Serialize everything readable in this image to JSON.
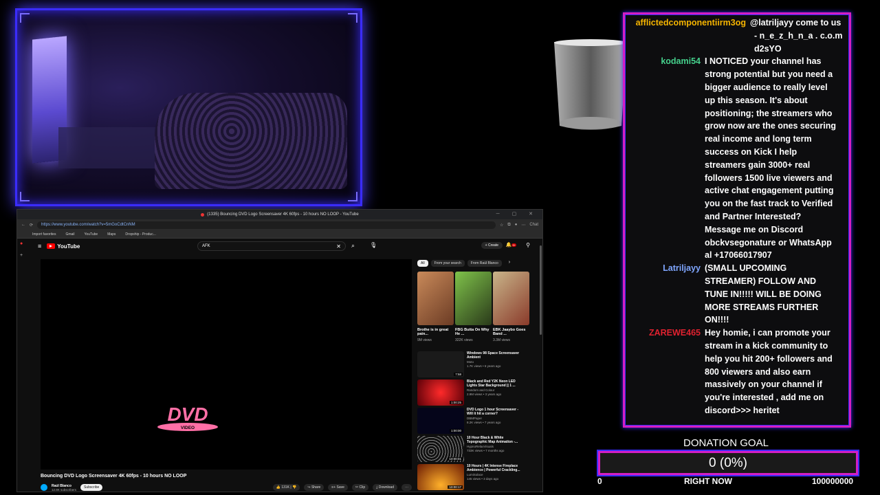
{
  "browser": {
    "tab_title": "(1335) Bouncing DVD Logo Screensaver 4K 60fps - 10 hours NO LOOP - YouTube",
    "url": "https://www.youtube.com/watch?v=5mGoCdtCnNM",
    "bookmarks": [
      "Import favorites",
      "Gmail",
      "YouTube",
      "Maps",
      "Dropship - Produc..."
    ],
    "extra_label": "Chat"
  },
  "youtube": {
    "logo": "YouTube",
    "search_value": "AFK",
    "create_label": "+ Create",
    "notif_count": "9+",
    "video_title": "Bouncing DVD Logo Screensaver 4K 60fps - 10 hours NO LOOP",
    "channel_name": "Raúl Blanco",
    "subscribers": "12.8K subscribers",
    "subscribe_label": "Subscribe",
    "likes": "131K",
    "actions": [
      "Share",
      "Save",
      "Clip",
      "Download"
    ],
    "dvd_text": "DVD",
    "dvd_sub": "VIDEO",
    "chips": [
      "All",
      "From your search",
      "From Raúl Blanco"
    ],
    "shorts": [
      {
        "title": "Brothe is in great pain...",
        "views": "9M views",
        "color": "#6b3b24"
      },
      {
        "title": "FBG Butta On Why He ...",
        "views": "322K views",
        "color": "#3f6a2a"
      },
      {
        "title": "EBK Jaaybo Goes Band ...",
        "views": "3.3M views",
        "color": "#8a7a5a"
      }
    ],
    "recs": [
      {
        "title": "Windows 98 Space Screensaver Ambient",
        "channel": "Moto",
        "stats": "1.7K views • 6 years ago",
        "duration": "7:58",
        "color": "#1a1a1a"
      },
      {
        "title": "Black and Red Y2K Neon LED Lights Star Background || 1 ...",
        "channel": "Random and Colour",
        "stats": "2.9M views • 3 years ago",
        "duration": "1:00:25",
        "color": "#b3121a"
      },
      {
        "title": "DVD Logo 1 hour Screensaver - Will it hit a corner?",
        "channel": "DBMPaper",
        "stats": "8.2K views • 7 years ago",
        "duration": "1:00:00",
        "color": "#05051a"
      },
      {
        "title": "10 Hour Black & White Topographic Map Animation -...",
        "channel": "HypnoRelaxVisuals",
        "stats": "733K views • 7 months ago",
        "duration": "10:00:01",
        "color": "#2a2a2a"
      },
      {
        "title": "10 Hours | 4K Intense Fireplace Ambience | Powerful Crackling...",
        "channel": "LumiSolace",
        "stats": "145 views • 3 days ago",
        "duration": "10:00:17",
        "color": "#a4360c"
      }
    ]
  },
  "chat": {
    "messages": [
      {
        "user": "afflictedcomponentiirm3og",
        "color": "#f5b400",
        "lines": [
          "@latriljayy come to us",
          "- n_e_z_h_n_a . c.o.m",
          "d2sYO"
        ]
      },
      {
        "user": "kodami54",
        "color": "#45d08c",
        "lines": [
          "I NOTICED your channel has",
          "strong potential but you need a",
          "bigger audience to really level",
          "up this season. It's about",
          "positioning; the streamers who",
          "grow now are the ones securing",
          "real income and long term",
          "success on Kick I help",
          "streamers gain 3000+ real",
          "followers 1500 live viewers and",
          "active chat engagement putting",
          "you on the fast track to Verified",
          "and Partner Interested?",
          "Message me on Discord",
          "obckvsegonature or WhatsApp",
          "al +17066017907"
        ]
      },
      {
        "user": "Latriljayy",
        "color": "#7fa6ff",
        "lines": [
          "(SMALL UPCOMING",
          "STREAMER) FOLLOW AND",
          "TUNE IN!!!!! WILL BE DOING",
          "MORE STREAMS FURTHER",
          "ON!!!!"
        ]
      },
      {
        "user": "ZAREWE465",
        "color": "#e0212f",
        "lines": [
          "Hey homie, i can promote your",
          "stream in a kick community to",
          "help you hit 200+ followers and",
          "800 viewers and also earn",
          "massively on your channel if",
          "you're interested , add me on",
          "discord>>> heritet"
        ]
      }
    ]
  },
  "donation": {
    "title": "DONATION GOAL",
    "value_text": "0 (0%)",
    "progress": 0,
    "min": "0",
    "mid": "RIGHT NOW",
    "max": "100000000"
  }
}
